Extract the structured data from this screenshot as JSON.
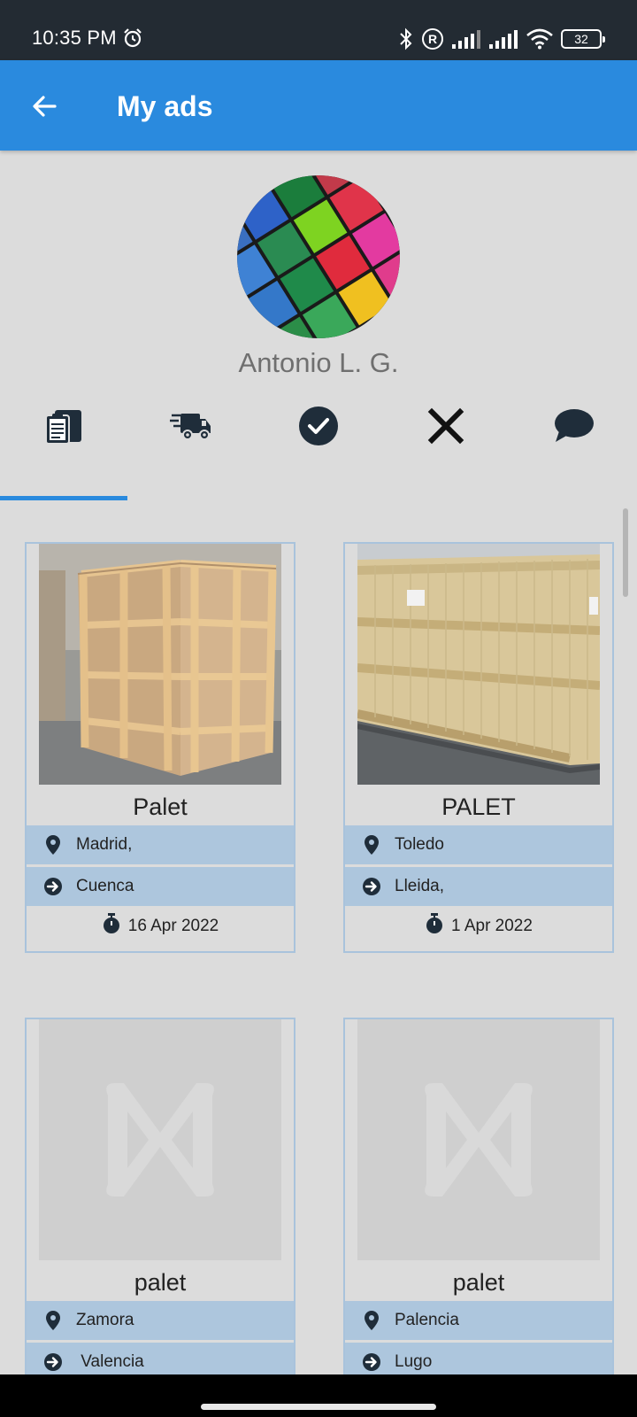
{
  "status_bar": {
    "time": "10:35 PM",
    "battery": "32",
    "icons": [
      "alarm-icon",
      "bluetooth-icon",
      "registered-icon",
      "signal-icon",
      "signal-icon",
      "wifi-icon",
      "battery-icon"
    ]
  },
  "app_bar": {
    "title": "My ads",
    "back_icon": "arrow-left-icon",
    "color": "#2a8ade"
  },
  "profile": {
    "name": "Antonio L. G."
  },
  "tabs": [
    {
      "icon": "documents-icon",
      "selected": true
    },
    {
      "icon": "truck-icon",
      "selected": false
    },
    {
      "icon": "check-circle-icon",
      "selected": false
    },
    {
      "icon": "close-icon",
      "selected": false
    },
    {
      "icon": "chat-icon",
      "selected": false
    }
  ],
  "ads": [
    {
      "title": "Palet",
      "from": "Madrid,",
      "to": "Cuenca",
      "date": "16 Apr 2022",
      "image": "wooden-crate-photo"
    },
    {
      "title": "PALET",
      "from": "Toledo",
      "to": "Lleida,",
      "date": "1 Apr 2022",
      "image": "wooden-crate-photo"
    },
    {
      "title": "palet",
      "from": "Zamora",
      "to": " Valencia",
      "date": "",
      "image": "placeholder-logo"
    },
    {
      "title": "palet",
      "from": "Palencia",
      "to": "Lugo",
      "date": "",
      "image": "placeholder-logo"
    }
  ],
  "row_icons": {
    "from": "map-pin-icon",
    "to": "arrow-right-circle-icon",
    "date": "stopwatch-icon"
  }
}
